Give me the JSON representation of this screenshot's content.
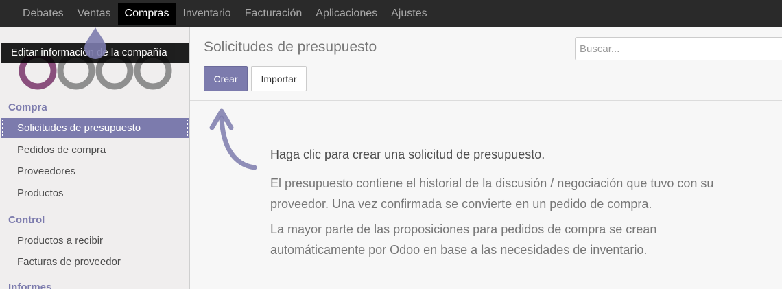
{
  "topbar": {
    "menu": [
      {
        "label": "Debates",
        "active": false
      },
      {
        "label": "Ventas",
        "active": false
      },
      {
        "label": "Compras",
        "active": true
      },
      {
        "label": "Inventario",
        "active": false
      },
      {
        "label": "Facturación",
        "active": false
      },
      {
        "label": "Aplicaciones",
        "active": false
      },
      {
        "label": "Ajustes",
        "active": false
      }
    ]
  },
  "sidebar": {
    "tooltip": "Editar información de la compañía",
    "sections": [
      {
        "title": "Compra",
        "items": [
          "Solicitudes de presupuesto",
          "Pedidos de compra",
          "Proveedores",
          "Productos"
        ]
      },
      {
        "title": "Control",
        "items": [
          "Productos a recibir",
          "Facturas de proveedor"
        ]
      },
      {
        "title": "Informes",
        "items": []
      }
    ],
    "active_item": "Solicitudes de presupuesto"
  },
  "control_panel": {
    "title": "Solicitudes de presupuesto",
    "search_placeholder": "Buscar...",
    "create_label": "Crear",
    "import_label": "Importar"
  },
  "help": {
    "lead": "Haga clic para crear una solicitud de presupuesto.",
    "p1": "El presupuesto contiene el historial de la discusión / negociación que tuvo con su proveedor. Una vez confirmada se convierte en un pedido de compra.",
    "p2": "La mayor parte de las proposiciones para pedidos de compra se crean automáticamente por Odoo en base a las necesidades de inventario."
  },
  "colors": {
    "accent": "#7c7bad",
    "logo_active": "#8a4f7d",
    "logo_inactive": "#8f8f8f"
  }
}
